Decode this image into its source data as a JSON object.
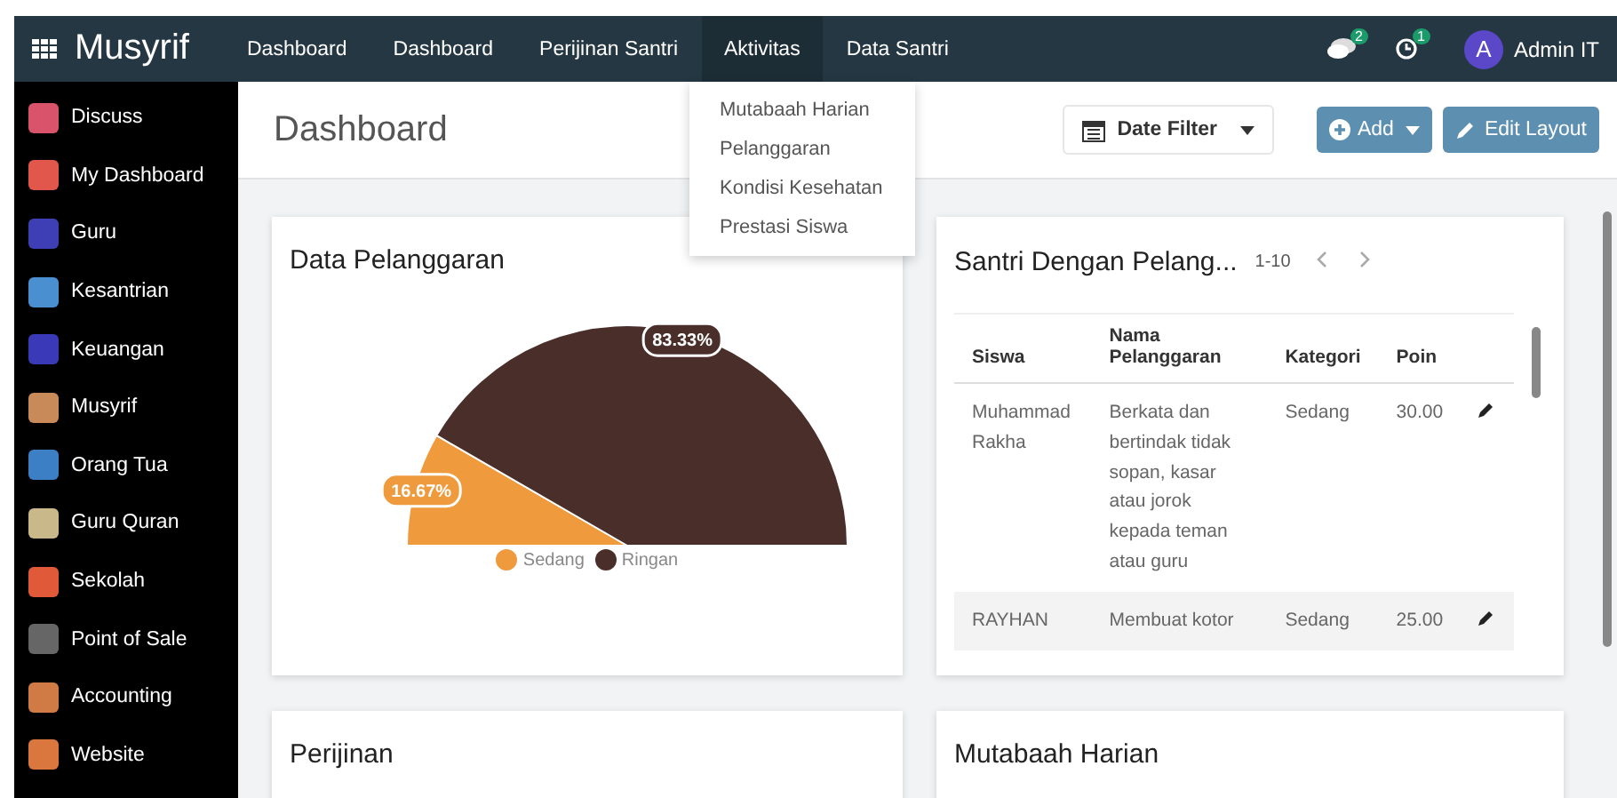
{
  "app": {
    "title": "Musyrif"
  },
  "top_menu": [
    {
      "label": "Dashboard",
      "selected": false
    },
    {
      "label": "Dashboard",
      "selected": false
    },
    {
      "label": "Perijinan Santri",
      "selected": false
    },
    {
      "label": "Aktivitas",
      "selected": true
    },
    {
      "label": "Data Santri",
      "selected": false
    }
  ],
  "dropdown": {
    "items": [
      "Mutabaah Harian",
      "Pelanggaran",
      "Kondisi Kesehatan",
      "Prestasi Siswa"
    ]
  },
  "systray": {
    "messages_badge": "2",
    "activity_badge": "1",
    "user_initial": "A",
    "user_name": "Admin IT"
  },
  "sidebar": {
    "items": [
      {
        "label": "Discuss",
        "color": "#d9536a"
      },
      {
        "label": "My Dashboard",
        "color": "#e2574c"
      },
      {
        "label": "Guru",
        "color": "#3f3fb5"
      },
      {
        "label": "Kesantrian",
        "color": "#4a8fd0"
      },
      {
        "label": "Keuangan",
        "color": "#3a3ab8"
      },
      {
        "label": "Musyrif",
        "color": "#c98a5a"
      },
      {
        "label": "Orang Tua",
        "color": "#3d7fc4"
      },
      {
        "label": "Guru Quran",
        "color": "#c9b98a"
      },
      {
        "label": "Sekolah",
        "color": "#e05a3a"
      },
      {
        "label": "Point of Sale",
        "color": "#666666"
      },
      {
        "label": "Accounting",
        "color": "#d07a45"
      },
      {
        "label": "Website",
        "color": "#d9773f"
      }
    ]
  },
  "page": {
    "title": "Dashboard",
    "date_filter": "Date Filter",
    "add_button": "Add",
    "edit_button": "Edit Layout"
  },
  "pelanggaran_card": {
    "title": "Data Pelanggaran",
    "chart_data": {
      "type": "pie",
      "categories": [
        "Sedang",
        "Ringan"
      ],
      "values": [
        16.67,
        83.33
      ],
      "colors": [
        "#ef9a3c",
        "#4a2e2a"
      ],
      "value_labels": [
        "16.67%",
        "83.33%"
      ],
      "legend": "bottom"
    }
  },
  "santri_card": {
    "title": "Santri Dengan Pelang...",
    "pager": "1-10",
    "columns": [
      "Siswa",
      "Nama Pelanggaran",
      "Kategori",
      "Poin"
    ],
    "rows": [
      {
        "siswa": "Muhammad Rakha",
        "pelanggaran": "Berkata dan bertindak tidak sopan, kasar atau jorok kepada teman atau guru",
        "kategori": "Sedang",
        "poin": "30.00",
        "selected": false
      },
      {
        "siswa": "RAYHAN",
        "pelanggaran": "Membuat kotor",
        "kategori": "Sedang",
        "poin": "25.00",
        "selected": true
      }
    ]
  },
  "bottom_cards": [
    {
      "title": "Perijinan"
    },
    {
      "title": "Mutabaah Harian"
    }
  ]
}
